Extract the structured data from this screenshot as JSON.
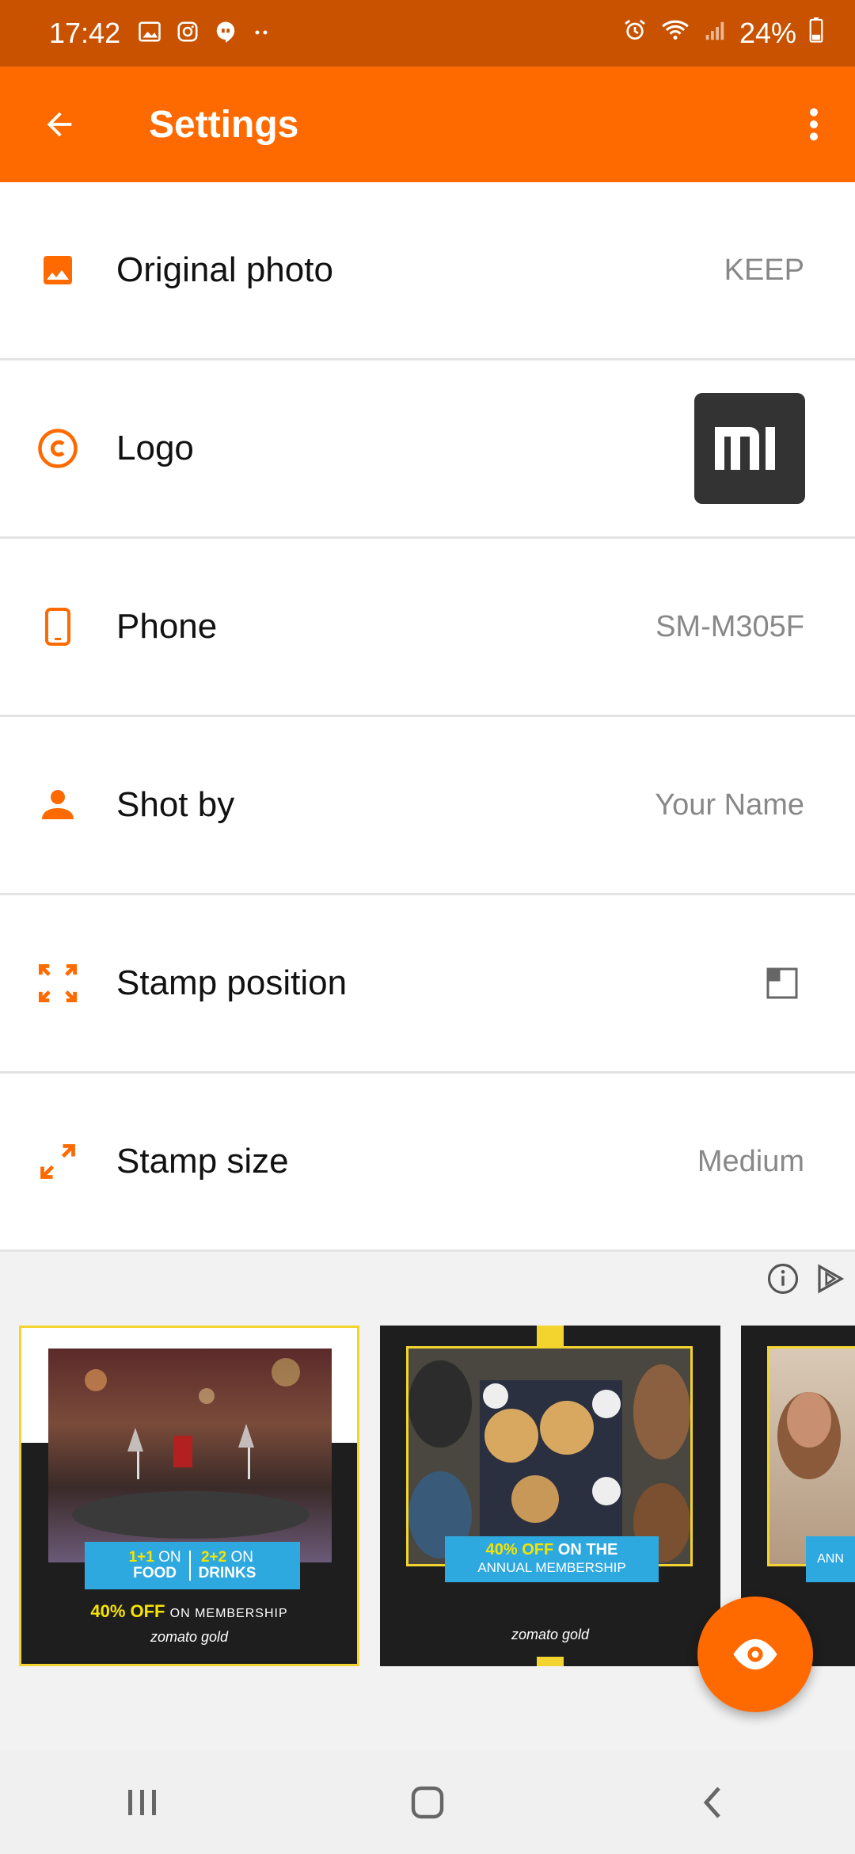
{
  "status": {
    "time": "17:42",
    "battery": "24%",
    "left_icons": [
      "gallery-icon",
      "instagram-icon",
      "hangouts-icon",
      "dots-icon"
    ],
    "right_icons": [
      "alarm-icon",
      "wifi-icon",
      "signal-icon",
      "battery-icon"
    ]
  },
  "appbar": {
    "title": "Settings",
    "icons": [
      "back-arrow-icon",
      "more-vert-icon"
    ]
  },
  "settings": [
    {
      "label": "Original photo",
      "value": "KEEP",
      "icon": "image-icon"
    },
    {
      "label": "Logo",
      "value": "",
      "icon": "copyright-icon",
      "logo_text": "mi"
    },
    {
      "label": "Phone",
      "value": "SM-M305F",
      "icon": "smartphone-icon"
    },
    {
      "label": "Shot by",
      "value": "Your Name",
      "icon": "person-icon"
    },
    {
      "label": "Stamp position",
      "value": "",
      "icon": "expand-corners-icon"
    },
    {
      "label": "Stamp size",
      "value": "Medium",
      "icon": "resize-diagonal-icon"
    }
  ],
  "ads": {
    "controls": [
      "info-icon",
      "adchoices-icon"
    ],
    "cards": [
      {
        "line1_a": "1+1",
        "line1_b": "ON",
        "line1_c": "FOOD",
        "line2_a": "2+2",
        "line2_b": "ON",
        "line2_c": "DRINKS",
        "offer_highlight": "40% OFF",
        "offer_rest": "ON MEMBERSHIP",
        "brand": "zomato gold"
      },
      {
        "offer_highlight": "40% OFF",
        "offer_rest": "ON THE",
        "offer_line2": "ANNUAL MEMBERSHIP",
        "brand": "zomato gold"
      },
      {
        "offer_line2": "ANN"
      }
    ]
  },
  "fab": {
    "icon": "eye-icon"
  },
  "nav": {
    "icons": [
      "recents-icon",
      "home-icon",
      "back-icon"
    ]
  },
  "colors": {
    "primary": "#ff6a00",
    "status_bar": "#c85200",
    "ad_blue": "#2ea9e0",
    "ad_yellow": "#f6e300"
  }
}
